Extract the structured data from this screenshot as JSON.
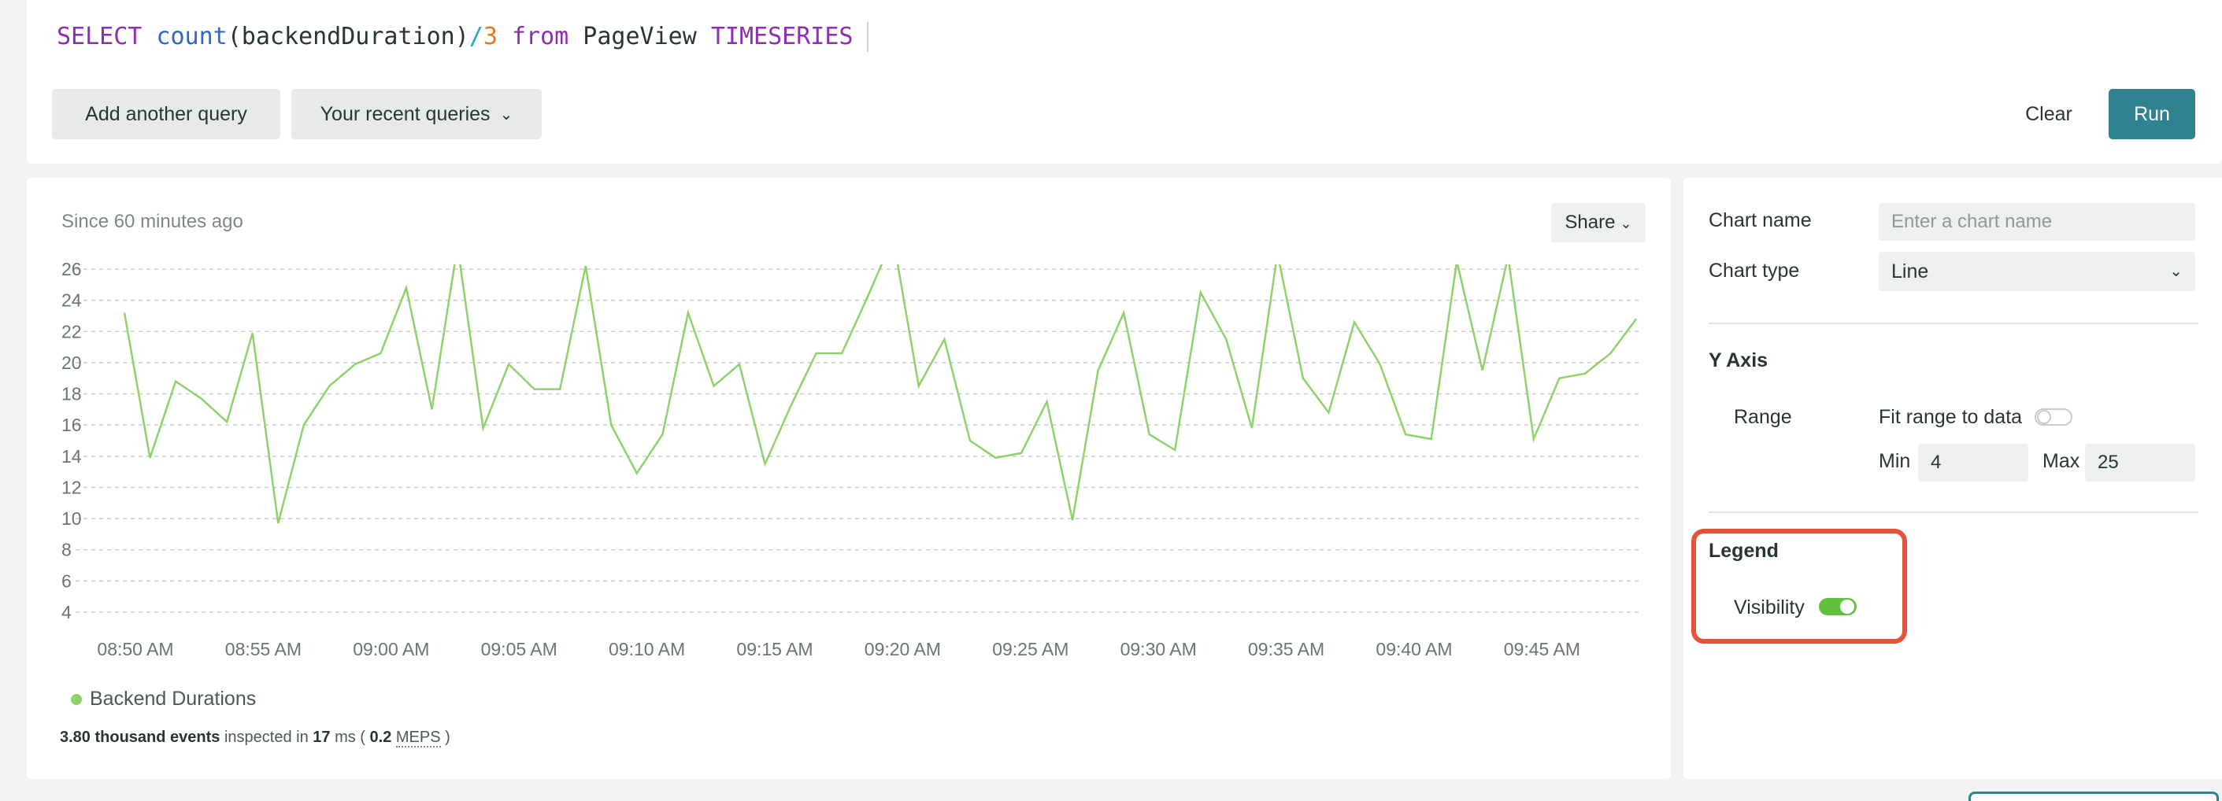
{
  "query": {
    "tokens": [
      {
        "text": "SELECT",
        "kind": "kw"
      },
      {
        "text": " ",
        "kind": "id"
      },
      {
        "text": "count",
        "kind": "fn"
      },
      {
        "text": "(backendDuration)",
        "kind": "id"
      },
      {
        "text": "/",
        "kind": "slash"
      },
      {
        "text": "3",
        "kind": "num"
      },
      {
        "text": " ",
        "kind": "id"
      },
      {
        "text": "from",
        "kind": "kw"
      },
      {
        "text": " PageView ",
        "kind": "id"
      },
      {
        "text": "TIMESERIES",
        "kind": "kw"
      }
    ],
    "add_query_label": "Add another query",
    "recent_queries_label": "Your recent queries",
    "clear_label": "Clear",
    "run_label": "Run"
  },
  "chart_panel": {
    "since_label": "Since 60 minutes ago",
    "share_label": "Share",
    "legend_label": "Backend Durations",
    "stats": {
      "events": "3.80 thousand events",
      "inspected_in": " inspected in ",
      "ms_value": "17",
      "ms_unit": " ms ( ",
      "meps_value": "0.2",
      "meps_label": "MEPS",
      "close": " )"
    }
  },
  "chart_data": {
    "type": "line",
    "title": "",
    "xlabel": "",
    "ylabel": "",
    "ylim": [
      4,
      26
    ],
    "yticks": [
      4,
      6,
      8,
      10,
      12,
      14,
      16,
      18,
      20,
      22,
      24,
      26
    ],
    "x_tick_labels": [
      "08:50 AM",
      "08:55 AM",
      "09:00 AM",
      "09:05 AM",
      "09:10 AM",
      "09:15 AM",
      "09:20 AM",
      "09:25 AM",
      "09:30 AM",
      "09:35 AM",
      "09:40 AM",
      "09:45 AM"
    ],
    "grid": true,
    "line_color": "#8fd16a",
    "series": [
      {
        "name": "Backend Durations",
        "values": [
          23.2,
          13.9,
          18.8,
          17.7,
          16.2,
          21.9,
          9.7,
          16.0,
          18.5,
          19.9,
          20.6,
          24.8,
          17.0,
          27.5,
          15.8,
          19.9,
          18.3,
          18.3,
          26.2,
          16.0,
          12.9,
          15.4,
          23.2,
          18.5,
          19.9,
          13.5,
          17.2,
          20.6,
          20.6,
          24.2,
          28.0,
          18.5,
          21.5,
          15.0,
          13.9,
          14.2,
          17.5,
          9.9,
          19.5,
          23.2,
          15.4,
          14.4,
          24.5,
          21.5,
          15.8,
          27.0,
          19.0,
          16.8,
          22.6,
          19.9,
          15.4,
          15.1,
          26.5,
          19.5,
          26.8,
          15.1,
          19.0,
          19.3,
          20.6,
          22.8
        ]
      }
    ]
  },
  "settings": {
    "chart_name_label": "Chart name",
    "chart_name_placeholder": "Enter a chart name",
    "chart_type_label": "Chart type",
    "chart_type_value": "Line",
    "y_axis_heading": "Y Axis",
    "range_label": "Range",
    "fit_range_label": "Fit range to data",
    "fit_range_on": false,
    "min_label": "Min",
    "min_value": "4",
    "max_label": "Max",
    "max_value": "25",
    "legend_heading": "Legend",
    "visibility_label": "Visibility",
    "visibility_on": true
  },
  "colors": {
    "accent": "#2f8390",
    "highlight": "#e2533a",
    "toggle_on": "#62c13e"
  }
}
